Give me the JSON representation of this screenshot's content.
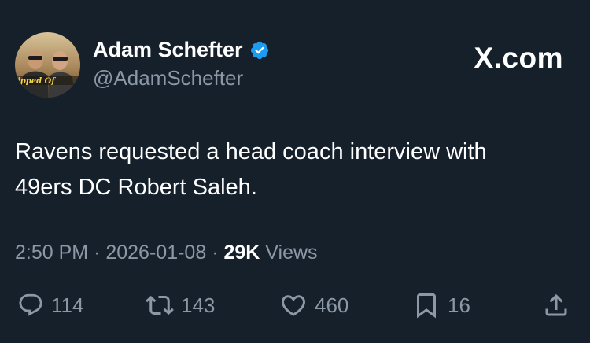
{
  "author": {
    "display_name": "Adam Schefter",
    "handle": "@AdamSchefter",
    "verified": true,
    "avatar_caption": "ipped Of"
  },
  "brand": "X.com",
  "tweet": {
    "lines": [
      "Ravens requested a head coach interview with",
      "49ers DC Robert Saleh."
    ]
  },
  "meta": {
    "time": "2:50 PM",
    "separator": "·",
    "date": "2026-01-08",
    "views_count": "29K",
    "views_label": "Views"
  },
  "actions": {
    "reply": {
      "icon": "reply-icon",
      "count": "114"
    },
    "repost": {
      "icon": "repost-icon",
      "count": "143"
    },
    "like": {
      "icon": "heart-icon",
      "count": "460"
    },
    "bookmark": {
      "icon": "bookmark-icon",
      "count": "16"
    },
    "share": {
      "icon": "share-icon"
    }
  },
  "colors": {
    "background": "#15202b",
    "text_primary": "#ffffff",
    "text_secondary": "#8b98a5",
    "verified_blue": "#1d9bf0"
  }
}
